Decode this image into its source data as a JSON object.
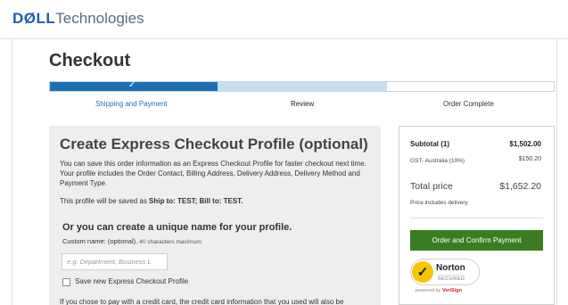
{
  "header": {
    "logo_dell": "DØLL",
    "logo_tech": "Technologies"
  },
  "page": {
    "title": "Checkout"
  },
  "progress": {
    "check_glyph": "✓",
    "steps": [
      {
        "label": "Shipping and Payment",
        "status": "completed"
      },
      {
        "label": "Review",
        "status": "current"
      },
      {
        "label": "Order Complete",
        "status": "upcoming"
      }
    ]
  },
  "profile": {
    "title": "Create Express Checkout Profile (optional)",
    "description": "You can save this order information as an Express Checkout Profile for faster checkout next time. Your profile includes the Order Contact, Billing Address, Delivery Address, Delivery Method and Payment Type.",
    "save_note_prefix": "This profile will be saved as ",
    "save_note_bold": "Ship to: TEST; Bill to: TEST.",
    "unique_title": "Or you can create a unique name for your profile.",
    "custom_name_label": "Custom name: (optional).",
    "custom_name_hint": "40 characters maximum.",
    "input_placeholder": "e.g. Department, Business L",
    "input_value": "",
    "checkbox_label": "Save new Express Checkout Profile",
    "checkbox_checked": false,
    "truncated_text": "If you chose to pay with a credit card, the credit card information that you used will also be"
  },
  "summary": {
    "subtotal_label": "Subtotal (1)",
    "subtotal_value": "$1,502.00",
    "gst_label": "GST- Australia (10%)",
    "gst_value": "$150.20",
    "total_label": "Total price",
    "total_value": "$1,652.20",
    "delivery_note": "Price includes delivery",
    "confirm_label": "Order and Confirm Payment"
  },
  "norton": {
    "name": "Norton",
    "secured": "SECURED",
    "powered_prefix": "powered by ",
    "powered_brand": "VeriSign"
  },
  "colors": {
    "brand_blue": "#1d6fb3",
    "progress_current": "#c6dff0",
    "confirm_green": "#3a7d21",
    "norton_yellow": "#f6c500"
  },
  "icons": {
    "progress_check": "check-icon",
    "norton_check": "norton-checkmark-icon"
  }
}
